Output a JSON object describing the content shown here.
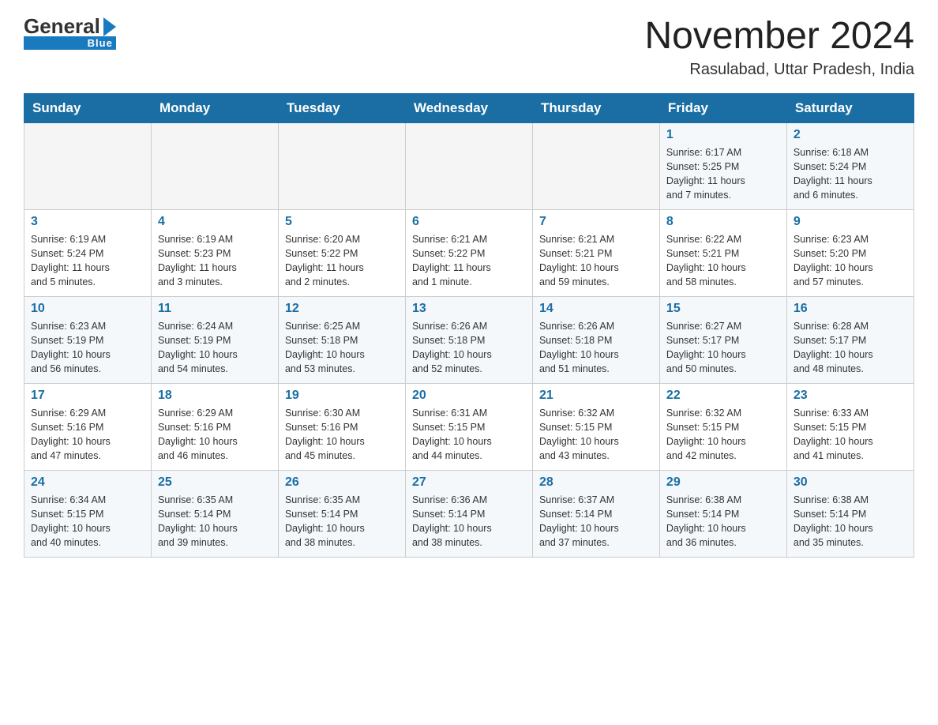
{
  "header": {
    "logo": {
      "general": "General",
      "blue": "Blue",
      "arrow": "▶"
    },
    "title": "November 2024",
    "location": "Rasulabad, Uttar Pradesh, India"
  },
  "days_of_week": [
    "Sunday",
    "Monday",
    "Tuesday",
    "Wednesday",
    "Thursday",
    "Friday",
    "Saturday"
  ],
  "weeks": [
    {
      "cells": [
        {
          "day": "",
          "info": "",
          "empty": true
        },
        {
          "day": "",
          "info": "",
          "empty": true
        },
        {
          "day": "",
          "info": "",
          "empty": true
        },
        {
          "day": "",
          "info": "",
          "empty": true
        },
        {
          "day": "",
          "info": "",
          "empty": true
        },
        {
          "day": "1",
          "info": "Sunrise: 6:17 AM\nSunset: 5:25 PM\nDaylight: 11 hours\nand 7 minutes.",
          "empty": false
        },
        {
          "day": "2",
          "info": "Sunrise: 6:18 AM\nSunset: 5:24 PM\nDaylight: 11 hours\nand 6 minutes.",
          "empty": false
        }
      ]
    },
    {
      "cells": [
        {
          "day": "3",
          "info": "Sunrise: 6:19 AM\nSunset: 5:24 PM\nDaylight: 11 hours\nand 5 minutes.",
          "empty": false
        },
        {
          "day": "4",
          "info": "Sunrise: 6:19 AM\nSunset: 5:23 PM\nDaylight: 11 hours\nand 3 minutes.",
          "empty": false
        },
        {
          "day": "5",
          "info": "Sunrise: 6:20 AM\nSunset: 5:22 PM\nDaylight: 11 hours\nand 2 minutes.",
          "empty": false
        },
        {
          "day": "6",
          "info": "Sunrise: 6:21 AM\nSunset: 5:22 PM\nDaylight: 11 hours\nand 1 minute.",
          "empty": false
        },
        {
          "day": "7",
          "info": "Sunrise: 6:21 AM\nSunset: 5:21 PM\nDaylight: 10 hours\nand 59 minutes.",
          "empty": false
        },
        {
          "day": "8",
          "info": "Sunrise: 6:22 AM\nSunset: 5:21 PM\nDaylight: 10 hours\nand 58 minutes.",
          "empty": false
        },
        {
          "day": "9",
          "info": "Sunrise: 6:23 AM\nSunset: 5:20 PM\nDaylight: 10 hours\nand 57 minutes.",
          "empty": false
        }
      ]
    },
    {
      "cells": [
        {
          "day": "10",
          "info": "Sunrise: 6:23 AM\nSunset: 5:19 PM\nDaylight: 10 hours\nand 56 minutes.",
          "empty": false
        },
        {
          "day": "11",
          "info": "Sunrise: 6:24 AM\nSunset: 5:19 PM\nDaylight: 10 hours\nand 54 minutes.",
          "empty": false
        },
        {
          "day": "12",
          "info": "Sunrise: 6:25 AM\nSunset: 5:18 PM\nDaylight: 10 hours\nand 53 minutes.",
          "empty": false
        },
        {
          "day": "13",
          "info": "Sunrise: 6:26 AM\nSunset: 5:18 PM\nDaylight: 10 hours\nand 52 minutes.",
          "empty": false
        },
        {
          "day": "14",
          "info": "Sunrise: 6:26 AM\nSunset: 5:18 PM\nDaylight: 10 hours\nand 51 minutes.",
          "empty": false
        },
        {
          "day": "15",
          "info": "Sunrise: 6:27 AM\nSunset: 5:17 PM\nDaylight: 10 hours\nand 50 minutes.",
          "empty": false
        },
        {
          "day": "16",
          "info": "Sunrise: 6:28 AM\nSunset: 5:17 PM\nDaylight: 10 hours\nand 48 minutes.",
          "empty": false
        }
      ]
    },
    {
      "cells": [
        {
          "day": "17",
          "info": "Sunrise: 6:29 AM\nSunset: 5:16 PM\nDaylight: 10 hours\nand 47 minutes.",
          "empty": false
        },
        {
          "day": "18",
          "info": "Sunrise: 6:29 AM\nSunset: 5:16 PM\nDaylight: 10 hours\nand 46 minutes.",
          "empty": false
        },
        {
          "day": "19",
          "info": "Sunrise: 6:30 AM\nSunset: 5:16 PM\nDaylight: 10 hours\nand 45 minutes.",
          "empty": false
        },
        {
          "day": "20",
          "info": "Sunrise: 6:31 AM\nSunset: 5:15 PM\nDaylight: 10 hours\nand 44 minutes.",
          "empty": false
        },
        {
          "day": "21",
          "info": "Sunrise: 6:32 AM\nSunset: 5:15 PM\nDaylight: 10 hours\nand 43 minutes.",
          "empty": false
        },
        {
          "day": "22",
          "info": "Sunrise: 6:32 AM\nSunset: 5:15 PM\nDaylight: 10 hours\nand 42 minutes.",
          "empty": false
        },
        {
          "day": "23",
          "info": "Sunrise: 6:33 AM\nSunset: 5:15 PM\nDaylight: 10 hours\nand 41 minutes.",
          "empty": false
        }
      ]
    },
    {
      "cells": [
        {
          "day": "24",
          "info": "Sunrise: 6:34 AM\nSunset: 5:15 PM\nDaylight: 10 hours\nand 40 minutes.",
          "empty": false
        },
        {
          "day": "25",
          "info": "Sunrise: 6:35 AM\nSunset: 5:14 PM\nDaylight: 10 hours\nand 39 minutes.",
          "empty": false
        },
        {
          "day": "26",
          "info": "Sunrise: 6:35 AM\nSunset: 5:14 PM\nDaylight: 10 hours\nand 38 minutes.",
          "empty": false
        },
        {
          "day": "27",
          "info": "Sunrise: 6:36 AM\nSunset: 5:14 PM\nDaylight: 10 hours\nand 38 minutes.",
          "empty": false
        },
        {
          "day": "28",
          "info": "Sunrise: 6:37 AM\nSunset: 5:14 PM\nDaylight: 10 hours\nand 37 minutes.",
          "empty": false
        },
        {
          "day": "29",
          "info": "Sunrise: 6:38 AM\nSunset: 5:14 PM\nDaylight: 10 hours\nand 36 minutes.",
          "empty": false
        },
        {
          "day": "30",
          "info": "Sunrise: 6:38 AM\nSunset: 5:14 PM\nDaylight: 10 hours\nand 35 minutes.",
          "empty": false
        }
      ]
    }
  ]
}
